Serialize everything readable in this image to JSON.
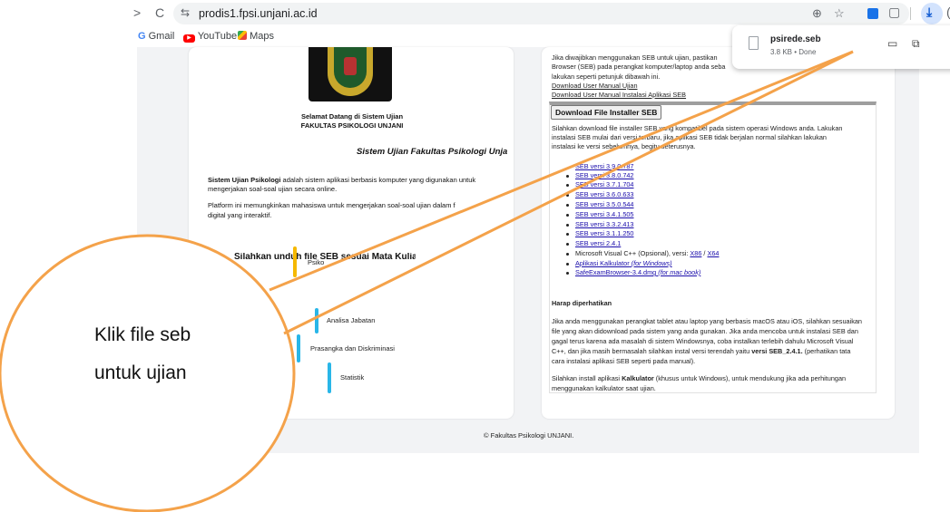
{
  "browser": {
    "forward_glyph": ">",
    "reload_glyph": "C",
    "site_info_glyph": "⇆",
    "url": "prodis1.fpsi.unjani.ac.id",
    "zoom_glyph": "⊕",
    "star_glyph": "☆",
    "puzzle_glyph": "▢",
    "download_glyph": "⤓",
    "profile_glyph": "(",
    "icons": [
      "forward-icon",
      "reload-icon",
      "site-info-icon",
      "zoom-icon",
      "bookmark-star-icon",
      "extension-icon",
      "extensions-puzzle-icon",
      "download-icon"
    ]
  },
  "bookmarks": [
    {
      "label": "Gmail",
      "icon": "G"
    },
    {
      "label": "YouTube",
      "icon": "▶"
    },
    {
      "label": "Maps",
      "icon": ""
    }
  ],
  "download_popup": {
    "file_name": "psirede.seb",
    "meta": "3.8 KB • Done",
    "folder_glyph": "▭",
    "open_glyph": "⧉"
  },
  "left_card": {
    "welcome_line1": "Selamat Datang di Sistem Ujian",
    "welcome_line2": "FAKULTAS PSIKOLOGI UNJANI",
    "subtitle": "Sistem Ujian Fakultas Psikologi Unja",
    "para1_bold": "Sistem Ujian Psikologi",
    "para1_rest": "adalah sistem aplikasi berbasis komputer yang digunakan untuk",
    "para1_line2": "mengerjakan soal-soal ujian secara online.",
    "para2_line1": "Platform ini memungkinkan mahasiswa untuk mengerjakan soal-soal ujian dalam f",
    "para2_line2": "digital yang interaktif.",
    "section_title": "Silahkan unduh file SEB sesuai Mata Kuliah",
    "courses": [
      {
        "label": "Psiko",
        "color": "#f5b800"
      },
      {
        "label": "Analisa Jabatan",
        "color": "#29b6e8"
      },
      {
        "label": "Prasangka dan Diskriminasi",
        "color": "#29b6e8"
      },
      {
        "label": "Statistik",
        "color": "#29b6e8"
      }
    ]
  },
  "right_card": {
    "intro_line1": "Jika diwajibkan menggunakan SEB untuk ujian, pastikan",
    "intro_line2": "Browser (SEB) pada perangkat komputer/laptop anda seba",
    "intro_line3": "lakukan seperti petunjuk dibawah ini.",
    "link_manual": "Download User Manual Ujian",
    "link_install_manual": "Download User Manual Instalasi Aplikasi SEB",
    "installer_button": "Download File Installer SEB",
    "desc_line1": "Silahkan download file installer SEB yang kompatibel pada sistem operasi Windows anda. Lakukan",
    "desc_line2": "instalasi SEB mulai dari versi terbaru, jika aplikasi SEB tidak berjalan normal silahkan lakukan",
    "desc_line3": "instalasi ke versi sebelumnya, begitu seterusnya.",
    "versions": [
      "SEB versi 3.9.0.787",
      "SEB versi 3.8.0.742",
      "SEB versi 3.7.1.704",
      "SEB versi 3.6.0.633",
      "SEB versi 3.5.0.544",
      "SEB versi 3.4.1.505",
      "SEB versi 3.3.2.413",
      "SEB versi 3.1.1.250",
      "SEB versi 2.4.1"
    ],
    "vc_text": "Microsoft Visual C++ (Opsional), versi:",
    "vc_x86": "X86",
    "vc_sep": "/",
    "vc_x64": "X64",
    "calc_link": "Aplikasi Kalkulator",
    "calc_note": "(for Windows)",
    "mac_link": "SafeExamBrowser-3.4.dmg",
    "mac_note": "(for mac book)",
    "attention_title": "Harap diperhatikan",
    "att_line1": "Jika anda menggunakan perangkat tablet atau laptop yang berbasis macOS atau iOS, silahkan sesuaikan",
    "att_line2": "file yang akan didownload pada sistem yang anda gunakan. Jika anda mencoba untuk instalasi SEB dan",
    "att_line3": "gagal terus karena ada masalah di sistem Windowsnya, coba instalkan terlebih dahulu Microsoft Visual",
    "att_line4a": "C++, dan jika masih bermasalah silahkan instal versi terendah yaitu",
    "att_line4b": "versi SEB_2.4.1.",
    "att_line4c": "(perhatikan tata",
    "att_line5": "cara instalasi aplikasi SEB seperti pada manual).",
    "calc_line1a": "Silahkan install aplikasi",
    "calc_line1b": "Kalkulator",
    "calc_line1c": "(khusus untuk Windows), untuk mendukung jika ada perhitungan",
    "calc_line2": "menggunakan kalkulator saat ujian."
  },
  "footer": "© Fakultas Psikologi UNJANI.",
  "annotation": {
    "line1": "Klik file seb",
    "line2": "untuk ujian",
    "color": "#f4a24a"
  }
}
